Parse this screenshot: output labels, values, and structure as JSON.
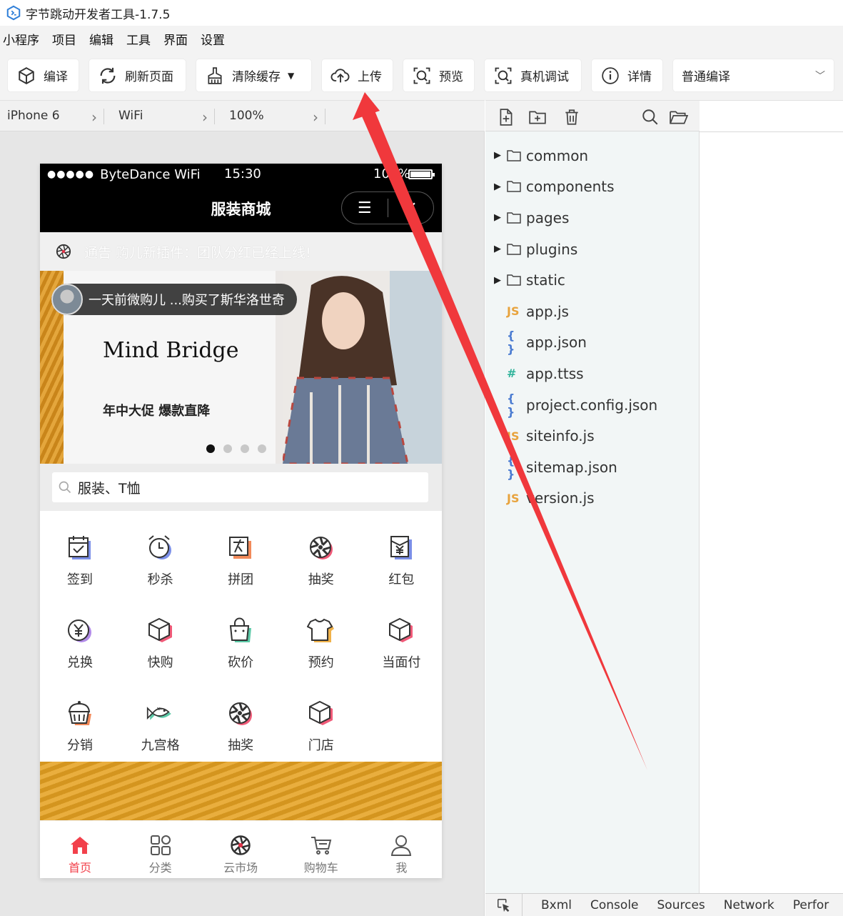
{
  "titlebar": {
    "title": "字节跳动开发者工具-1.7.5"
  },
  "menu": {
    "items": [
      "小程序",
      "项目",
      "编辑",
      "工具",
      "界面",
      "设置"
    ]
  },
  "toolbar": {
    "compile": "编译",
    "refresh": "刷新页面",
    "clear_cache": "清除缓存",
    "upload": "上传",
    "preview": "预览",
    "device_debug": "真机调试",
    "details": "详情",
    "compile_mode": "普通编译"
  },
  "simulator": {
    "device": "iPhone 6",
    "network": "WiFi",
    "zoom": "100%",
    "status": {
      "signal": "●●●●●",
      "carrier": "ByteDance WiFi",
      "time": "15:30",
      "battery": "100%"
    },
    "battery_level": 1.0,
    "page_title": "服装商城",
    "notice": "通告 购儿新插件：团队分红已经上线!",
    "banner": {
      "toast": "一天前微购儿 ...购买了斯华洛世奇",
      "brand": "Mind Bridge",
      "promo": "年中大促 爆款直降",
      "dots_count": 4,
      "active_dot": 0
    },
    "search_placeholder": "服装、T恤",
    "grid": [
      {
        "label": "签到",
        "icon": "calendar-check-icon"
      },
      {
        "label": "秒杀",
        "icon": "alarm-clock-icon"
      },
      {
        "label": "拼团",
        "icon": "group-buy-icon"
      },
      {
        "label": "抽奖",
        "icon": "lottery-wheel-icon"
      },
      {
        "label": "红包",
        "icon": "red-envelope-icon"
      },
      {
        "label": "兑换",
        "icon": "yuan-coin-icon"
      },
      {
        "label": "快购",
        "icon": "box-icon"
      },
      {
        "label": "砍价",
        "icon": "bag-icon"
      },
      {
        "label": "预约",
        "icon": "tshirt-icon"
      },
      {
        "label": "当面付",
        "icon": "box-icon"
      },
      {
        "label": "分销",
        "icon": "cupcake-icon"
      },
      {
        "label": "九宫格",
        "icon": "fish-icon"
      },
      {
        "label": "抽奖",
        "icon": "lottery-wheel-icon"
      },
      {
        "label": "门店",
        "icon": "box-icon"
      }
    ],
    "tabs": [
      {
        "label": "首页",
        "icon": "home-icon",
        "active": true
      },
      {
        "label": "分类",
        "icon": "category-grid-icon",
        "active": false
      },
      {
        "label": "云市场",
        "icon": "market-wheel-icon",
        "active": false
      },
      {
        "label": "购物车",
        "icon": "cart-icon",
        "active": false
      },
      {
        "label": "我",
        "icon": "user-icon",
        "active": false
      }
    ]
  },
  "explorer": {
    "folders": [
      "common",
      "components",
      "pages",
      "plugins",
      "static"
    ],
    "files": [
      {
        "name": "app.js",
        "icon": "JS"
      },
      {
        "name": "app.json",
        "icon": "{ }"
      },
      {
        "name": "app.ttss",
        "icon": "#"
      },
      {
        "name": "project.config.json",
        "icon": "{ }"
      },
      {
        "name": "siteinfo.js",
        "icon": "JS"
      },
      {
        "name": "sitemap.json",
        "icon": "{ }"
      },
      {
        "name": "version.js",
        "icon": "JS"
      }
    ]
  },
  "devtools": {
    "tabs": [
      "Bxml",
      "Console",
      "Sources",
      "Network",
      "Perfor"
    ]
  },
  "colors": {
    "accent_red": "#f2404b",
    "js_icon": "#e8a33d",
    "json_icon": "#4a7bd1",
    "css_icon": "#2fb39a",
    "arrow": "#f0383c"
  }
}
